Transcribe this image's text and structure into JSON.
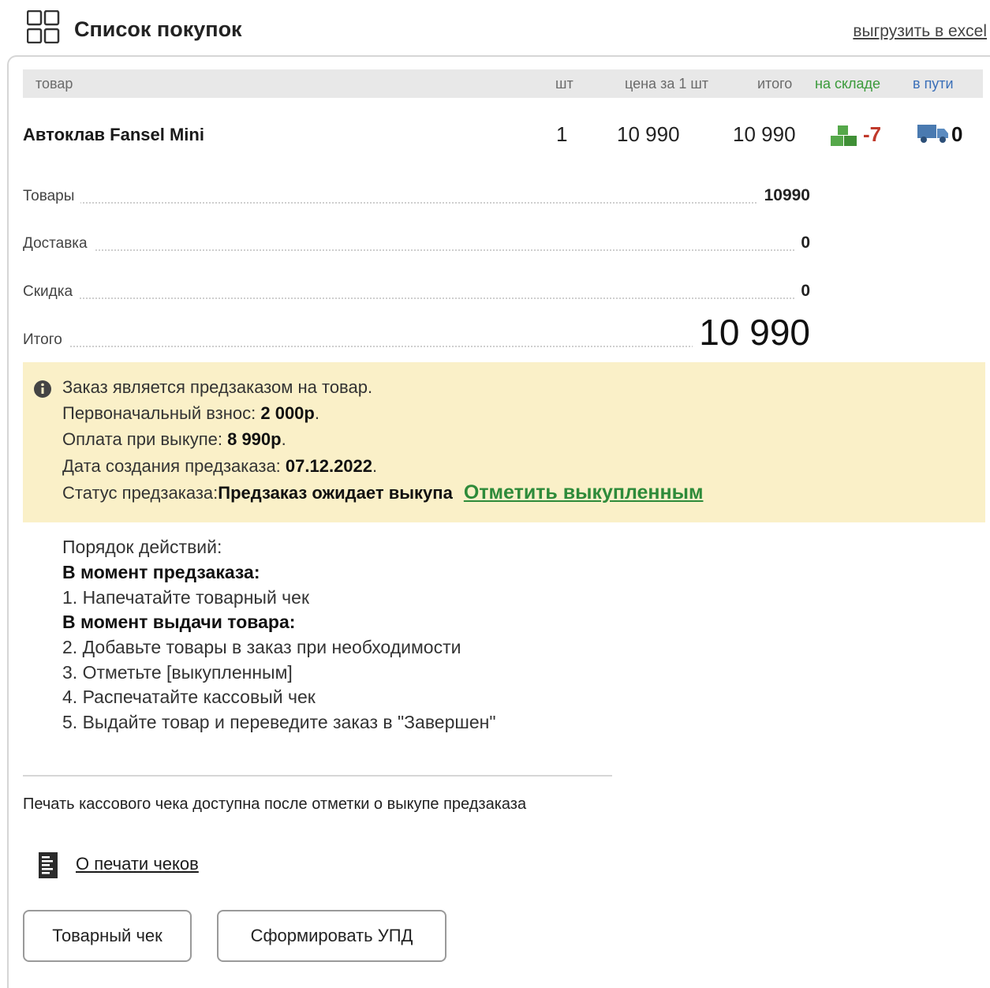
{
  "header": {
    "title": "Список покупок",
    "export_link": "выгрузить в excel"
  },
  "table": {
    "columns": {
      "product": "товар",
      "qty": "шт",
      "price": "цена за 1 шт",
      "total": "итого",
      "in_stock": "на складе",
      "in_transit": "в пути"
    },
    "rows": [
      {
        "name": "Автоклав Fansel Mini",
        "qty": "1",
        "price": "10 990",
        "total": "10 990",
        "in_stock": "-7",
        "in_transit": "0"
      }
    ]
  },
  "summary": {
    "goods_label": "Товары",
    "goods_value": "10990",
    "delivery_label": "Доставка",
    "delivery_value": "0",
    "discount_label": "Скидка",
    "discount_value": "0",
    "total_label": "Итого",
    "total_value": "10 990"
  },
  "preorder": {
    "line1": "Заказ является предзаказом на товар.",
    "deposit_label": "Первоначальный взнос: ",
    "deposit_value": "2 000р",
    "payment_label": "Оплата при выкупе: ",
    "payment_value": "8 990р",
    "date_label": "Дата создания предзаказа: ",
    "date_value": "07.12.2022",
    "status_label": "Статус предзаказа:",
    "status_value": "Предзаказ ожидает выкупа",
    "mark_link": "Отметить выкупленным",
    "period": "."
  },
  "steps": [
    "Порядок действий:",
    "В момент предзаказа:",
    "1. Напечатайте товарный чек",
    "В момент выдачи товара:",
    "2. Добавьте товары в заказ при необходимости",
    "3. Отметьте [выкупленным]",
    "4. Распечатайте кассовый чек",
    "5. Выдайте товар и переведите заказ в \"Завершен\""
  ],
  "print_note": "Печать кассового чека доступна после отметки о выкупе предзаказа",
  "receipt_link": "О печати чеков",
  "buttons": {
    "sales_receipt": "Товарный чек",
    "upd": "Сформировать УПД"
  },
  "icons": {
    "grid": "grid-icon",
    "stock": "warehouse-boxes-icon",
    "transit": "truck-icon",
    "info": "info-icon",
    "receipt": "receipt-icon"
  },
  "colors": {
    "alert_bg": "#faf0c8",
    "stock_negative": "#c0392b",
    "link_green": "#2e8b3a",
    "header_in_stock": "#3a9a3a",
    "header_in_transit": "#3a6fb8"
  }
}
